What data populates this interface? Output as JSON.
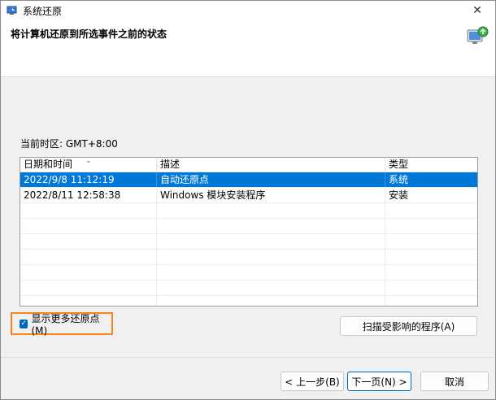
{
  "window": {
    "title": "系统还原",
    "close_glyph": "✕"
  },
  "header": {
    "title": "将计算机还原到所选事件之前的状态"
  },
  "timezone": {
    "label": "当前时区: GMT+8:00"
  },
  "table": {
    "columns": [
      "日期和时间",
      "描述",
      "类型"
    ],
    "rows": [
      {
        "date": "2022/9/8 11:12:19",
        "desc": "自动还原点",
        "type": "系统",
        "selected": true
      },
      {
        "date": "2022/8/11 12:58:38",
        "desc": "Windows 模块安装程序",
        "type": "安装",
        "selected": false
      }
    ],
    "sort_glyph": "⌄"
  },
  "show_more": {
    "label": "显示更多还原点(M)",
    "checked": true,
    "check_glyph": "✓"
  },
  "buttons": {
    "scan": "扫描受影响的程序(A)",
    "back": "< 上一步(B)",
    "next": "下一页(N) >",
    "cancel": "取消"
  },
  "colors": {
    "selection": "#0078d7",
    "highlight_border": "#f5861f",
    "checkbox": "#0067c0"
  }
}
